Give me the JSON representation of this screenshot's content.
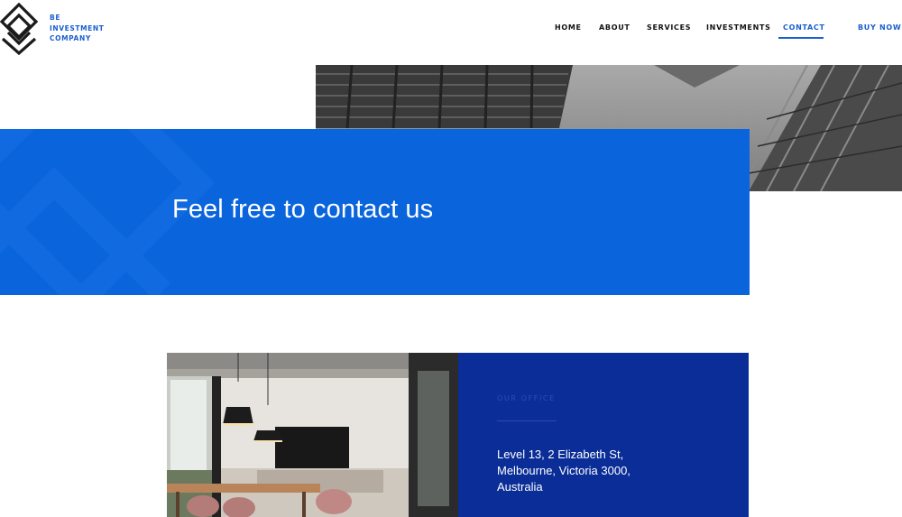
{
  "brand": {
    "lines": [
      "BE",
      "INVESTMENT",
      "COMPANY"
    ],
    "color": "#1a5fcf"
  },
  "nav": {
    "items": [
      "HOME",
      "ABOUT",
      "SERVICES",
      "INVESTMENTS",
      "CONTACT"
    ],
    "active": "CONTACT",
    "buy_now": "BUY NOW"
  },
  "hero": {
    "title": "Feel free to contact us",
    "banner_color": "#0a64dc"
  },
  "office": {
    "label": "OUR OFFICE",
    "address_lines": [
      "Level 13, 2 Elizabeth St,",
      "Melbourne, Victoria 3000,",
      "Australia"
    ],
    "panel_color": "#0a2d97"
  }
}
